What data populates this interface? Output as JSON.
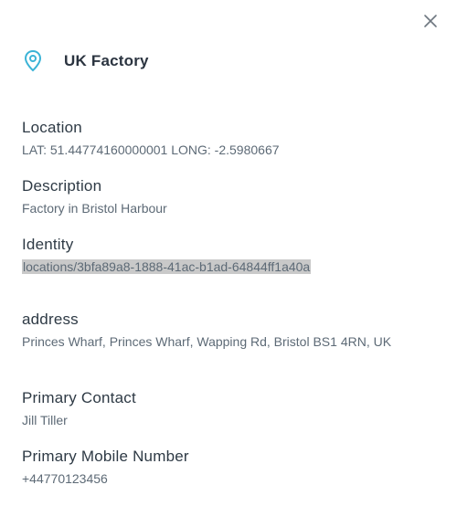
{
  "header": {
    "title": "UK Factory"
  },
  "fields": {
    "location": {
      "label": "Location",
      "value": "LAT: 51.44774160000001 LONG: -2.5980667"
    },
    "description": {
      "label": "Description",
      "value": "Factory in Bristol Harbour"
    },
    "identity": {
      "label": "Identity",
      "value": "locations/3bfa89a8-1888-41ac-b1ad-64844ff1a40a"
    },
    "address": {
      "label": "address",
      "value": "Princes Wharf, Princes Wharf, Wapping Rd, Bristol BS1 4RN, UK"
    },
    "primary_contact": {
      "label": "Primary Contact",
      "value": "Jill Tiller"
    },
    "primary_mobile": {
      "label": "Primary Mobile Number",
      "value": "+44770123456"
    }
  },
  "icons": {
    "close": "close-icon",
    "pin": "map-pin-icon"
  },
  "colors": {
    "accent": "#3bb3d6",
    "highlight": "#c9c9c9"
  }
}
